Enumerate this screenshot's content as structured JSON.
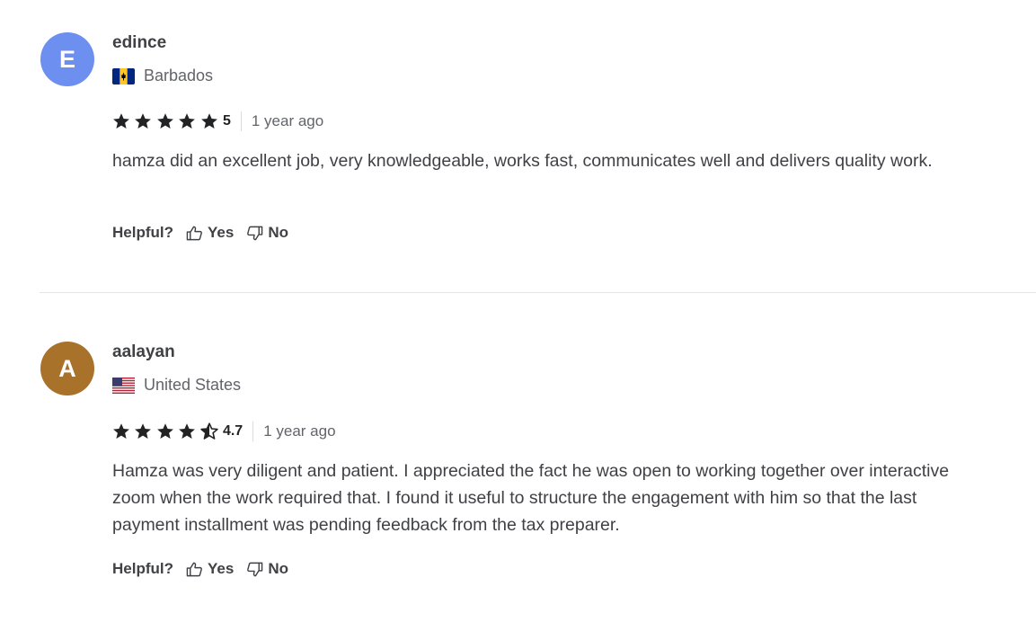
{
  "reviews": [
    {
      "avatar_letter": "E",
      "avatar_color": "#6c8ff0",
      "username": "edince",
      "country": "Barbados",
      "flag_icon": "barbados-flag-icon",
      "rating": "5",
      "rating_stars": 5,
      "time": "1 year ago",
      "text": "hamza did an excellent job, very knowledgeable, works fast, communicates well and delivers quality work.",
      "helpful_label": "Helpful?",
      "yes_label": "Yes",
      "no_label": "No"
    },
    {
      "avatar_letter": "A",
      "avatar_color": "#a8722b",
      "username": "aalayan",
      "country": "United States",
      "flag_icon": "united-states-flag-icon",
      "rating": "4.7",
      "rating_stars": 4.7,
      "time": "1 year ago",
      "text": "Hamza was very diligent and patient. I appreciated the fact he was open to working together over interactive zoom when the work required that. I found it useful to structure the engagement with him so that the last payment installment was pending feedback from the tax preparer.",
      "helpful_label": "Helpful?",
      "yes_label": "Yes",
      "no_label": "No"
    }
  ],
  "colors": {
    "star": "#222325",
    "text": "#404145",
    "muted": "#62646a",
    "divider": "#e4e5e7"
  }
}
